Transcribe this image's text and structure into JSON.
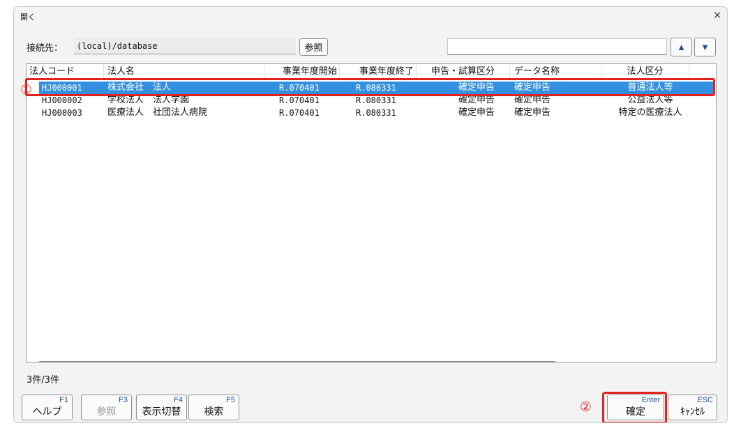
{
  "dialog": {
    "title": "開く",
    "close_symbol": "×",
    "accent_color": "#3390e0",
    "annotation_color": "#e0231e"
  },
  "connection": {
    "label": "接続先：",
    "value": "(local)/database",
    "ref_button_label": "参照"
  },
  "search": {
    "value": ""
  },
  "nav": {
    "up_icon": "triangle-up-icon",
    "down_icon": "triangle-down-icon",
    "up_symbol": "▲",
    "down_symbol": "▼"
  },
  "table": {
    "columns": [
      "法人コード",
      "法人名",
      "事業年度開始",
      "事業年度終了",
      "申告・試算区分",
      "データ名称",
      "法人区分"
    ],
    "rows": [
      {
        "code": "HJ000001",
        "name": "株式会社　法人",
        "start": "R.070401",
        "end": "R.080331",
        "type": "確定申告",
        "data_name": "確定申告",
        "category": "普通法人等",
        "selected": true
      },
      {
        "code": "HJ000002",
        "name": "学校法人　法人学園",
        "start": "R.070401",
        "end": "R.080331",
        "type": "確定申告",
        "data_name": "確定申告",
        "category": "公益法人等",
        "selected": false
      },
      {
        "code": "HJ000003",
        "name": "医療法人　社団法人病院",
        "start": "R.070401",
        "end": "R.080331",
        "type": "確定申告",
        "data_name": "確定申告",
        "category": "特定の医療法人",
        "selected": false
      }
    ]
  },
  "annotations": {
    "circle_1": "①",
    "circle_2": "②"
  },
  "status": {
    "count": "3件/3件"
  },
  "function_keys": {
    "f1": {
      "key": "F1",
      "label": "ヘルプ"
    },
    "f3": {
      "key": "F3",
      "label": "参照",
      "disabled": true
    },
    "f4": {
      "key": "F4",
      "label": "表示切替"
    },
    "f5": {
      "key": "F5",
      "label": "検索"
    },
    "enter": {
      "key": "Enter",
      "label": "確定"
    },
    "esc": {
      "key": "ESC",
      "label": "ｷｬﾝｾﾙ"
    }
  }
}
